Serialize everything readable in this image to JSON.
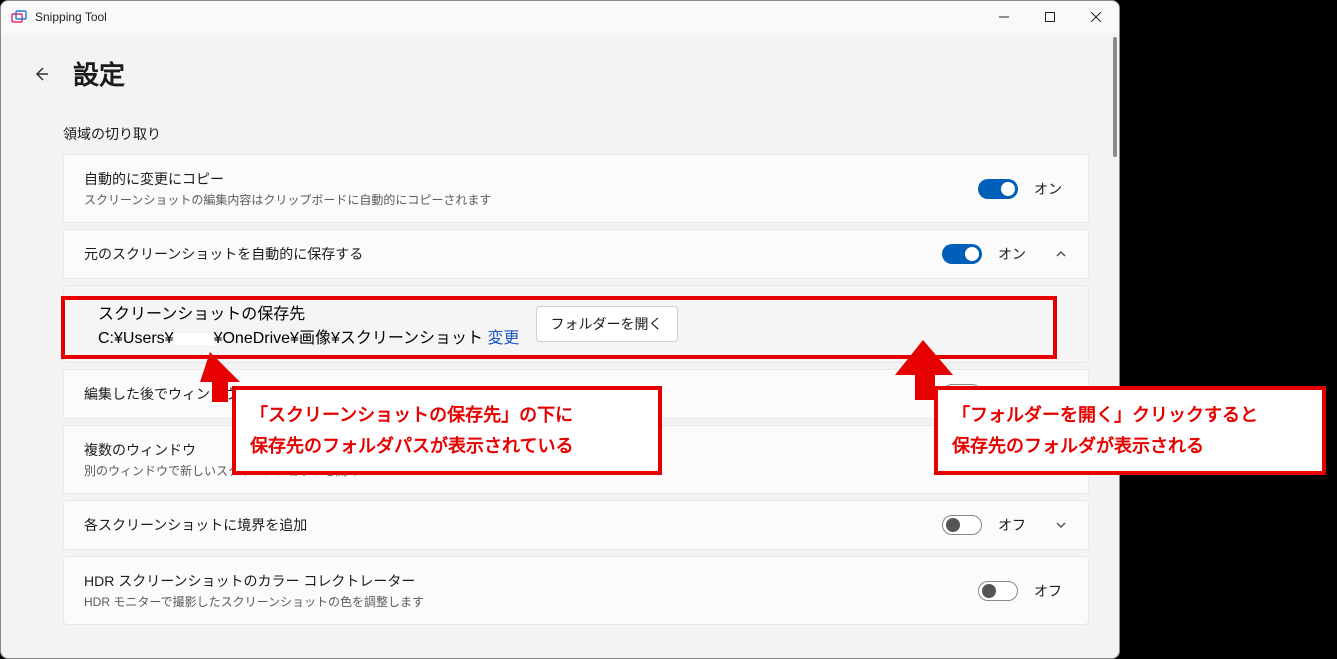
{
  "window": {
    "app_title": "Snipping Tool"
  },
  "page": {
    "title": "設定"
  },
  "section": {
    "label": "領域の切り取り"
  },
  "settings": {
    "auto_copy": {
      "title": "自動的に変更にコピー",
      "desc": "スクリーンショットの編集内容はクリップボードに自動的にコピーされます",
      "state": "オン"
    },
    "auto_save": {
      "title": "元のスクリーンショットを自動的に保存する",
      "state": "オン"
    },
    "save_location": {
      "title": "スクリーンショットの保存先",
      "path_prefix": "C:¥Users¥",
      "path_suffix": "¥OneDrive¥画像¥スクリーンショット",
      "change": "変更",
      "open_btn": "フォルダーを開く"
    },
    "close_after_edit": {
      "title_partial": "編集した後でウィンドウを"
    },
    "multi_window": {
      "title": "複数のウィンドウ",
      "desc": "別のウィンドウで新しいスクリーンショットを開く"
    },
    "add_border": {
      "title": "各スクリーンショットに境界を追加",
      "state": "オフ"
    },
    "hdr": {
      "title": "HDR スクリーンショットのカラー コレクトレーター",
      "desc": "HDR モニターで撮影したスクリーンショットの色を調整します",
      "state": "オフ"
    }
  },
  "annotations": {
    "left": {
      "line1": "「スクリーンショットの保存先」の下に",
      "line2": "保存先のフォルダパスが表示されている"
    },
    "right": {
      "line1": "「フォルダーを開く」クリックすると",
      "line2": "保存先のフォルダが表示される"
    }
  }
}
